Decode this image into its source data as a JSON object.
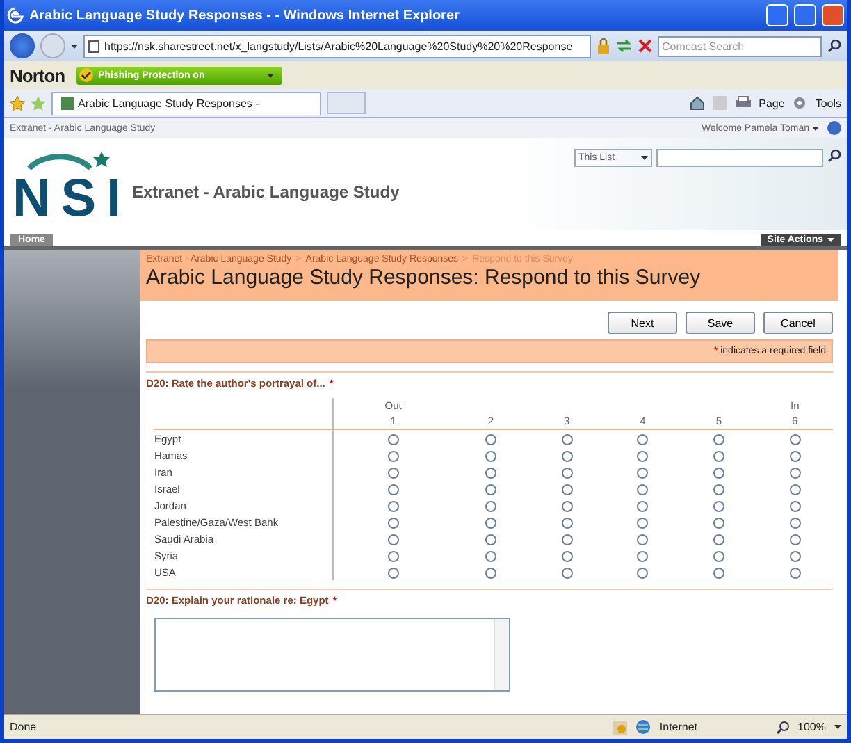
{
  "window": {
    "title": "Arabic Language Study Responses - - Windows Internet Explorer"
  },
  "address_bar": {
    "url": "https://nsk.sharestreet.net/x_langstudy/Lists/Arabic%20Language%20Study%20%20Response",
    "search_placeholder": "Comcast Search"
  },
  "norton": {
    "brand": "Norton",
    "status": "Phishing Protection on"
  },
  "tabs": [
    {
      "label": "Arabic Language Study Responses -",
      "selected": true
    }
  ],
  "command_bar": {
    "page": "Page",
    "tools": "Tools"
  },
  "site": {
    "site_name": "Extranet - Arabic Language Study",
    "welcome": "Welcome Pamela Toman",
    "logo": "NSI",
    "title": "Extranet - Arabic Language Study",
    "scope": "This List",
    "nav": [
      {
        "label": "Home",
        "selected": true
      }
    ],
    "site_actions": "Site Actions"
  },
  "breadcrumb": [
    {
      "label": "Extranet - Arabic Language Study",
      "kind": "link"
    },
    {
      "label": "Arabic Language Study Responses",
      "kind": "link"
    },
    {
      "label": "Respond to this Survey",
      "kind": "current"
    }
  ],
  "breadcrumb_separator": ">",
  "page_title": "Arabic Language Study Responses: Respond to this Survey",
  "buttons": [
    "Next",
    "Save",
    "Cancel"
  ],
  "required_mark": "*",
  "required_note": "indicates a required field",
  "question_1": {
    "label": "D20: Rate the author's portrayal of...",
    "required": true,
    "columns": [
      {
        "label": "1",
        "sub": "Out"
      },
      {
        "label": "2"
      },
      {
        "label": "3"
      },
      {
        "label": "4"
      },
      {
        "label": "5"
      },
      {
        "label": "6",
        "sub": "In"
      }
    ],
    "rows": [
      {
        "label": "Egypt",
        "options": [
          {
            "selected": false
          },
          {
            "selected": false
          },
          {
            "selected": false
          },
          {
            "selected": false
          },
          {
            "selected": false
          },
          {
            "selected": false
          }
        ]
      },
      {
        "label": "Hamas",
        "options": [
          {
            "selected": false
          },
          {
            "selected": false
          },
          {
            "selected": false
          },
          {
            "selected": false
          },
          {
            "selected": false
          },
          {
            "selected": false
          }
        ]
      },
      {
        "label": "Iran",
        "options": [
          {
            "selected": false
          },
          {
            "selected": false
          },
          {
            "selected": false
          },
          {
            "selected": false
          },
          {
            "selected": false
          },
          {
            "selected": false
          }
        ]
      },
      {
        "label": "Israel",
        "options": [
          {
            "selected": false
          },
          {
            "selected": false
          },
          {
            "selected": false
          },
          {
            "selected": false
          },
          {
            "selected": false
          },
          {
            "selected": false
          }
        ]
      },
      {
        "label": "Jordan",
        "options": [
          {
            "selected": false
          },
          {
            "selected": false
          },
          {
            "selected": false
          },
          {
            "selected": false
          },
          {
            "selected": false
          },
          {
            "selected": false
          }
        ]
      },
      {
        "label": "Palestine/Gaza/West Bank",
        "options": [
          {
            "selected": false
          },
          {
            "selected": false
          },
          {
            "selected": false
          },
          {
            "selected": false
          },
          {
            "selected": false
          },
          {
            "selected": false
          }
        ]
      },
      {
        "label": "Saudi Arabia",
        "options": [
          {
            "selected": false
          },
          {
            "selected": false
          },
          {
            "selected": false
          },
          {
            "selected": false
          },
          {
            "selected": false
          },
          {
            "selected": false
          }
        ]
      },
      {
        "label": "Syria",
        "options": [
          {
            "selected": false
          },
          {
            "selected": false
          },
          {
            "selected": false
          },
          {
            "selected": false
          },
          {
            "selected": false
          },
          {
            "selected": false
          }
        ]
      },
      {
        "label": "USA",
        "options": [
          {
            "selected": false
          },
          {
            "selected": false
          },
          {
            "selected": false
          },
          {
            "selected": false
          },
          {
            "selected": false
          },
          {
            "selected": false
          }
        ]
      }
    ]
  },
  "question_2": {
    "label": "D20: Explain your rationale re: Egypt",
    "required": true
  },
  "status_bar": {
    "text": "Done",
    "zone": "Internet",
    "zoom": "100%"
  }
}
